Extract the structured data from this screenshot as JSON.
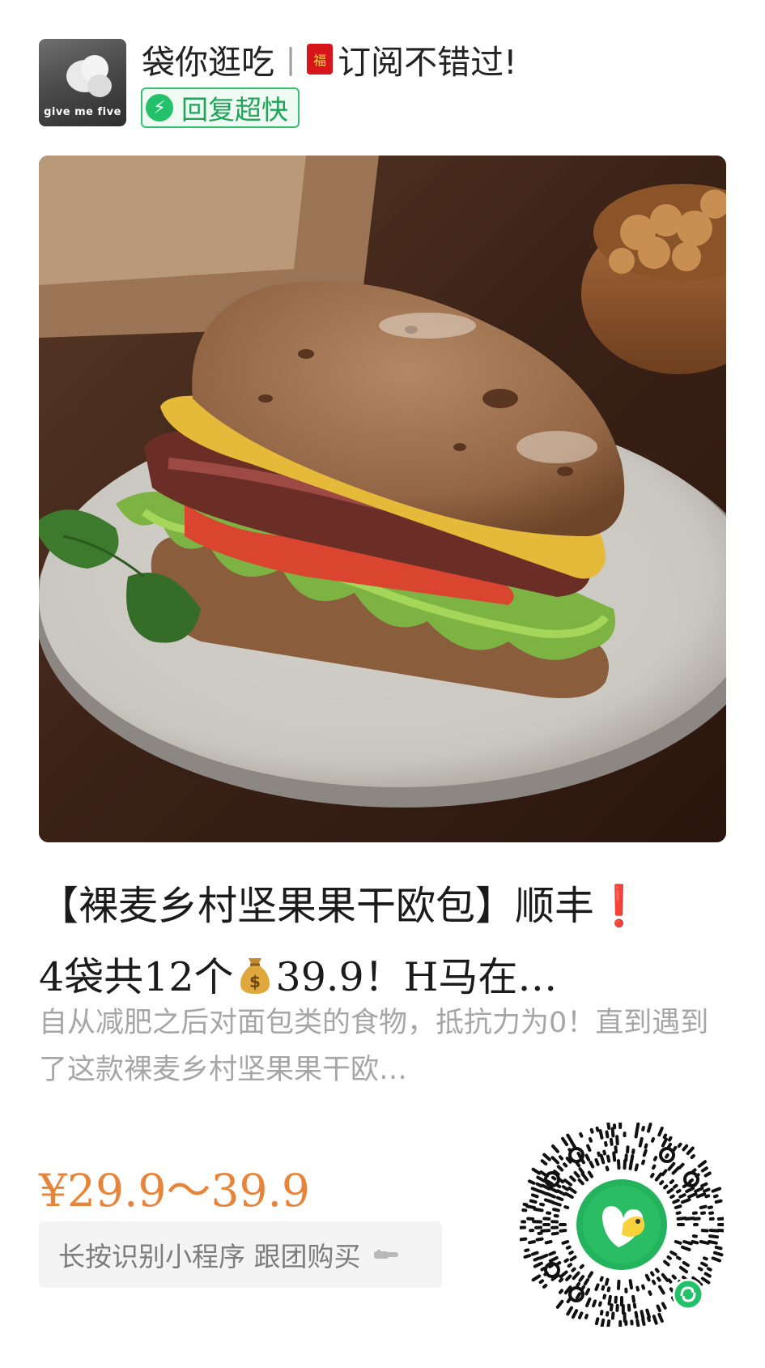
{
  "header": {
    "avatar_text": "give me five",
    "account_name": "袋你逛吃",
    "separator": "|",
    "fu_char": "福",
    "subscribe_text": "订阅不错过!",
    "reply_badge": "回复超快"
  },
  "product": {
    "title_line1_main": "【裸麦乡村坚果果干欧包】顺丰",
    "title_line1_mark": "❗",
    "title_line2_prefix": "4袋共12个",
    "title_line2_suffix": "39.9！H马在…",
    "description": "自从减肥之后对面包类的食物，抵抗力为0！直到遇到了这款裸麦乡村坚果果干欧…",
    "price": "¥29.9～39.9",
    "buy_button": "长按识别小程序 跟团购买"
  },
  "colors": {
    "price": "#e8843a",
    "reply_green": "#23c16a",
    "exclamation": "#e0201e"
  }
}
